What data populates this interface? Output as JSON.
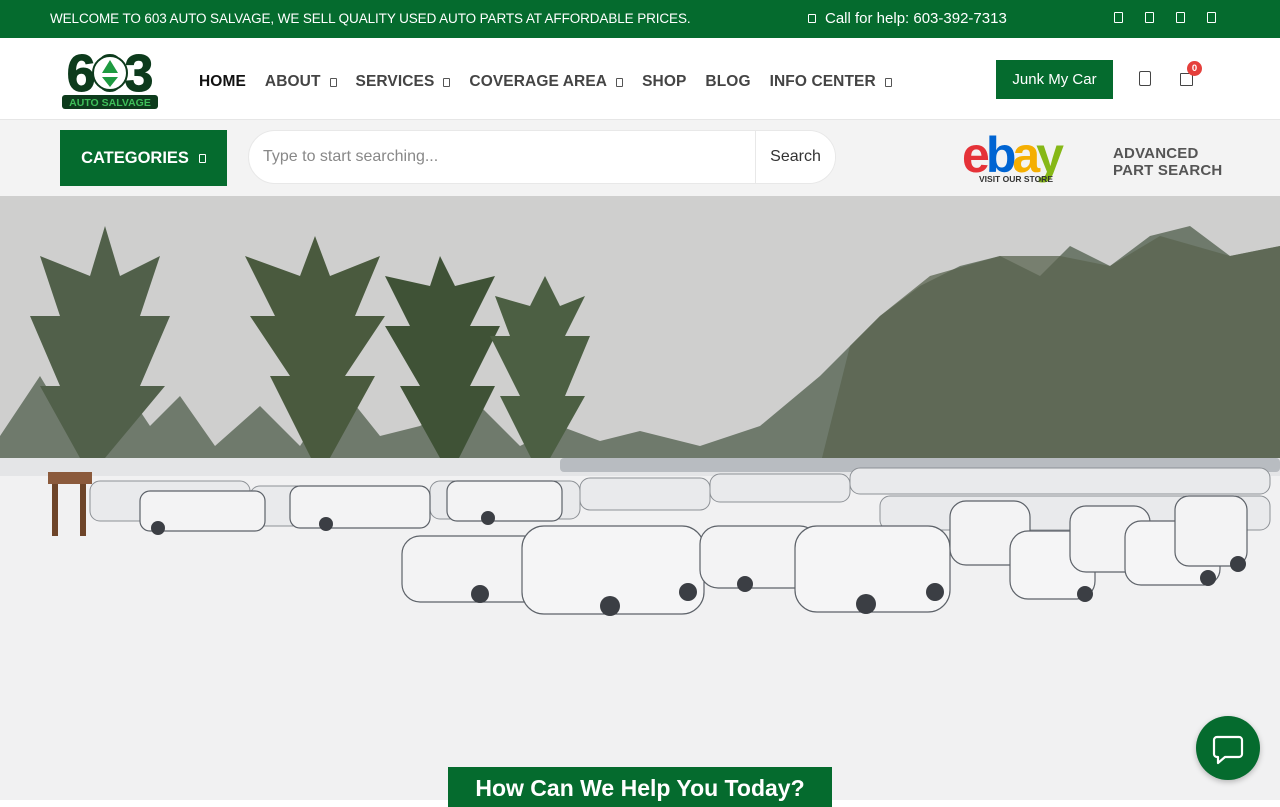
{
  "topbar": {
    "welcome": "WELCOME TO 603 AUTO SALVAGE, WE SELL QUALITY USED AUTO PARTS AT AFFORDABLE PRICES.",
    "phone": "Call for help: 603-392-7313"
  },
  "header": {
    "logo_number": "603",
    "logo_text": "AUTO SALVAGE",
    "nav": {
      "home": "HOME",
      "about": "ABOUT",
      "services": "SERVICES",
      "coverage": "COVERAGE AREA",
      "shop": "SHOP",
      "blog": "BLOG",
      "info": "INFO CENTER"
    },
    "junk_button": "Junk My Car",
    "cart_count": "0"
  },
  "searchbar": {
    "categories": "CATEGORIES",
    "placeholder": "Type to start searching...",
    "search_button": "Search",
    "ebay_caption": "VISIT OUR STORE",
    "advanced_line1": "ADVANCED",
    "advanced_line2": "PART SEARCH"
  },
  "hero": {
    "help_title": "How Can We Help You Today?"
  },
  "colors": {
    "brand_green": "#056b2e",
    "badge_red": "#e5403c"
  }
}
